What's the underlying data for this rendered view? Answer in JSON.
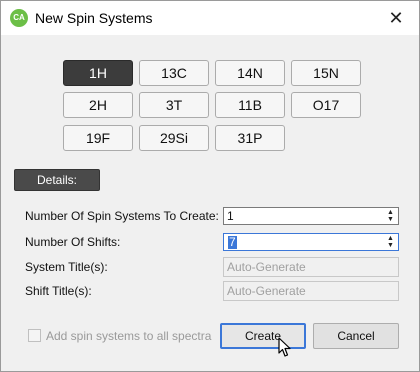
{
  "window": {
    "title": "New Spin Systems",
    "app_icon_text": "CA",
    "close_glyph": "✕"
  },
  "nuclei": {
    "selected": "1H",
    "rows": [
      [
        "1H",
        "13C",
        "14N",
        "15N"
      ],
      [
        "2H",
        "3T",
        "11B",
        "O17"
      ],
      [
        "19F",
        "29Si",
        "31P"
      ]
    ]
  },
  "details": {
    "label": "Details:"
  },
  "form": {
    "num_systems": {
      "label": "Number Of Spin Systems To Create:",
      "value": "1"
    },
    "num_shifts": {
      "label": "Number Of Shifts:",
      "value": "7"
    },
    "system_titles": {
      "label": "System Title(s):",
      "placeholder": "Auto-Generate"
    },
    "shift_titles": {
      "label": "Shift Title(s):",
      "placeholder": "Auto-Generate"
    }
  },
  "footer": {
    "add_to_spectra_label": "Add spin systems to all spectra",
    "add_to_spectra_checked": false,
    "create_label": "Create",
    "cancel_label": "Cancel"
  },
  "icons": {
    "spin_up": "up-arrow-icon",
    "spin_down": "down-arrow-icon",
    "pointer": "mouse-pointer-icon"
  }
}
